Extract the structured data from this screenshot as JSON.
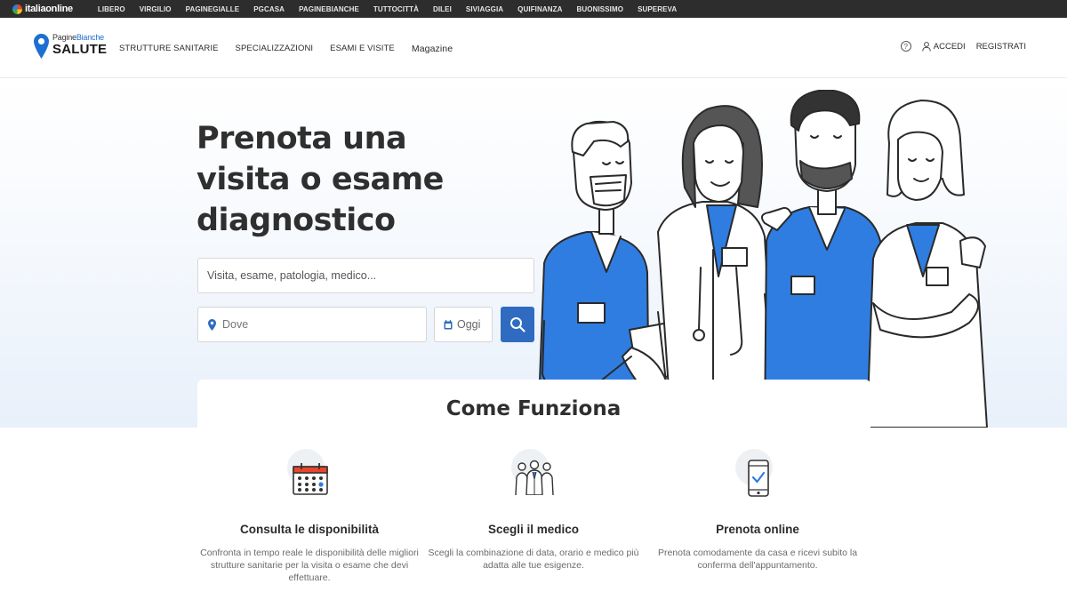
{
  "topbar": {
    "brand": "italiaonline",
    "links": [
      "LIBERO",
      "VIRGILIO",
      "PAGINEGIALLE",
      "PGCASA",
      "PAGINEBIANCHE",
      "TUTTOCITTÀ",
      "DILEI",
      "SIVIAGGIA",
      "QUIFINANZA",
      "BUONISSIMO",
      "SUPEREVA"
    ]
  },
  "header": {
    "logo_small_1": "Pagine",
    "logo_small_2": "Bianche",
    "logo_big": "SALUTE",
    "nav": [
      "STRUTTURE SANITARIE",
      "SPECIALIZZAZIONI",
      "ESAMI E VISITE",
      "Magazine"
    ],
    "help_icon": "?",
    "login": "ACCEDI",
    "register": "REGISTRATI"
  },
  "hero": {
    "title": "Prenota una visita o esame diagnostico",
    "search_placeholder": "Visita, esame, patologia, medico...",
    "where_placeholder": "Dove",
    "date_label": "Oggi"
  },
  "how": {
    "title": "Come Funziona",
    "steps": [
      {
        "icon": "calendar-icon",
        "title": "Consulta le disponibilità",
        "text": "Confronta in tempo reale le disponibilità delle migliori strutture sanitarie per la visita o esame che devi effettuare."
      },
      {
        "icon": "doctors-group-icon",
        "title": "Scegli il medico",
        "text": "Scegli la combinazione di data, orario e medico più adatta alle tue esigenze."
      },
      {
        "icon": "phone-check-icon",
        "title": "Prenota online",
        "text": "Prenota comodamente da casa e ricevi subito la conferma dell'appuntamento."
      }
    ]
  },
  "colors": {
    "accent_blue": "#2f6cc1",
    "scrubs_blue": "#2f7de1",
    "topbar_bg": "#2d2d2d"
  }
}
